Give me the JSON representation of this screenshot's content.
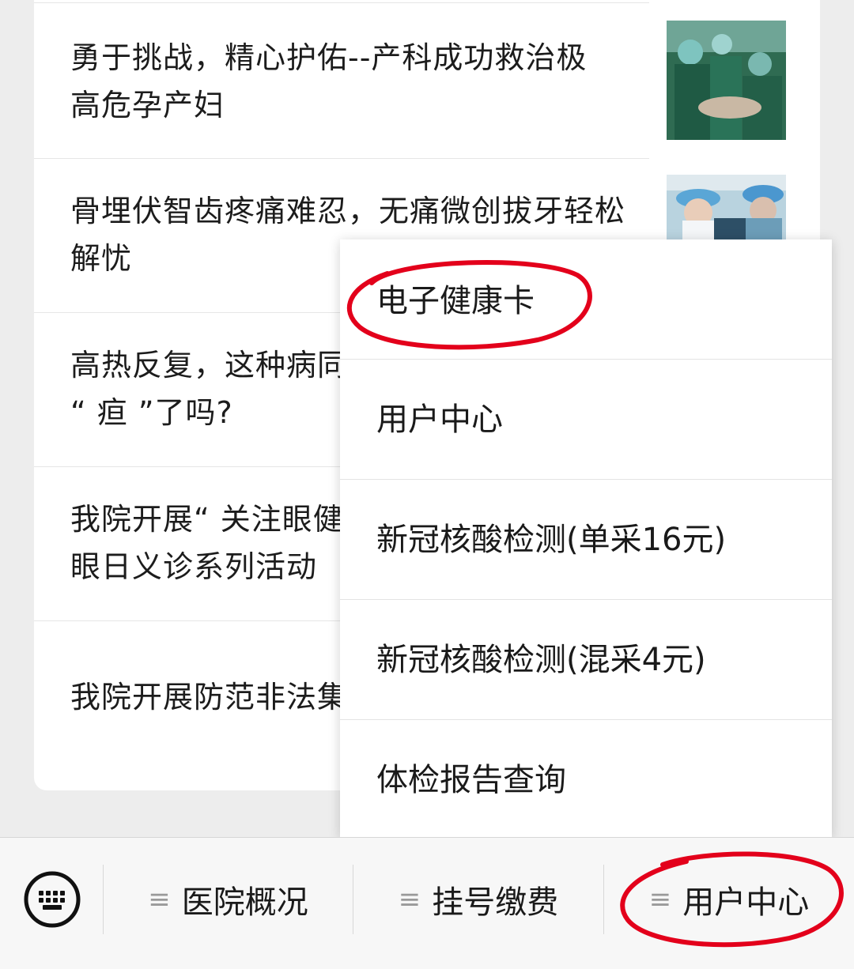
{
  "articles": [
    {
      "title": "勇于挑战，精心护佑--产科成功救治极高危孕产妇"
    },
    {
      "title": "骨埋伏智齿疼痛难忍，无痛微创拔牙轻松解忧"
    },
    {
      "title": "高热反复，这种病同样要警惕，你“疸”了吗?",
      "visible": "高热反复，这种病同",
      "line2": "“ 疸 ”了吗?"
    },
    {
      "title": "我院开展“关注眼健康”爱眼日义诊系列活动",
      "visible": "我院开展“ 关注眼健",
      "line2": "眼日义诊系列活动"
    },
    {
      "title": "我院开展防范非法集资宣传活动",
      "visible": "我院开展防范非法集"
    }
  ],
  "article_lines": {
    "a1_l1": "勇于挑战，精心护佑--产科成功救治极",
    "a1_l2": "高危孕产妇",
    "a2_l1": "骨埋伏智齿疼痛难忍，无痛微创拔牙轻松",
    "a2_l2": "解忧",
    "a3_l1": "高热反复，这种病同",
    "a3_l2": "“ 疸 ”了吗?",
    "a4_l1": "我院开展“ 关注眼健",
    "a4_l2": "眼日义诊系列活动",
    "a5_l1": "我院开展防范非法集"
  },
  "popup_menu": {
    "items": [
      {
        "label": "电子健康卡"
      },
      {
        "label": "用户中心"
      },
      {
        "label": "新冠核酸检测(单采16元)"
      },
      {
        "label": "新冠核酸检测(混采4元)"
      },
      {
        "label": "体检报告查询"
      }
    ]
  },
  "bottom_bar": {
    "keyboard_icon": "keyboard-icon",
    "tabs": [
      {
        "label": "医院概况",
        "icon": "menu-icon"
      },
      {
        "label": "挂号缴费",
        "icon": "menu-icon"
      },
      {
        "label": "用户中心",
        "icon": "menu-icon"
      }
    ]
  },
  "colors": {
    "annotation_red": "#e3001b",
    "background": "#ededed",
    "card": "#ffffff"
  }
}
